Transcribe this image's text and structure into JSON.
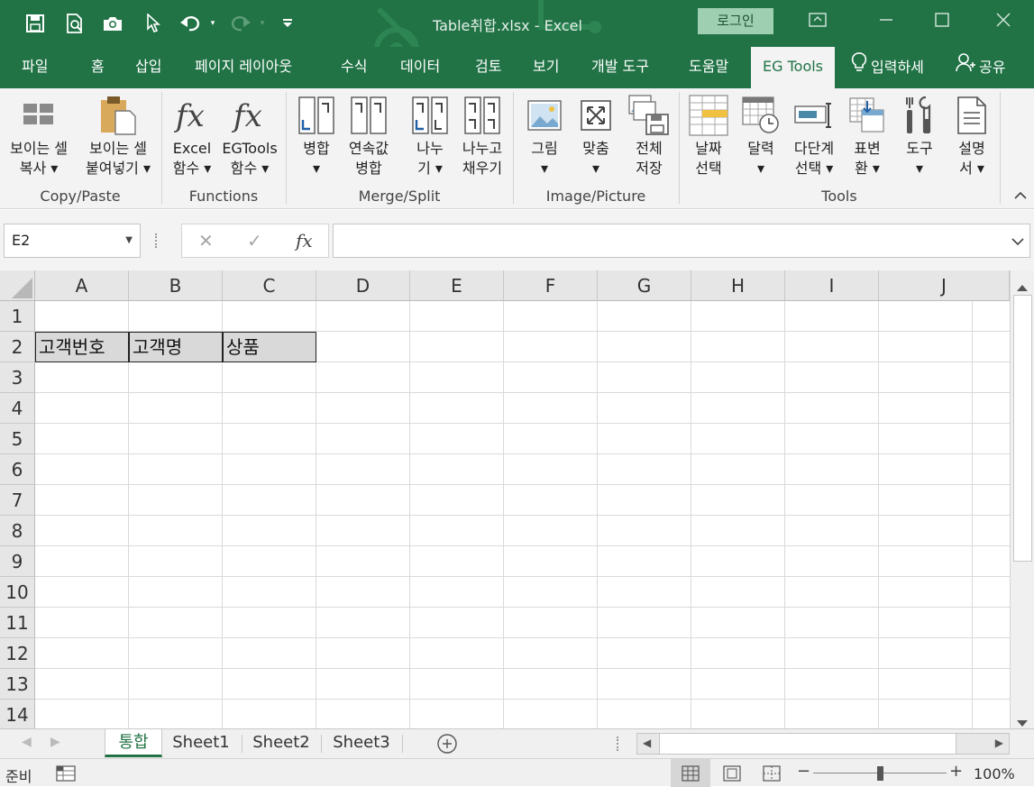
{
  "window": {
    "title": "Table취합.xlsx  -  Excel",
    "login_label": "로그인",
    "accent_color": "#217346"
  },
  "quick_access": {
    "icons": [
      "save-icon",
      "print-preview-icon",
      "camera-icon",
      "pointer-icon",
      "undo-icon",
      "redo-icon",
      "customize-icon"
    ]
  },
  "tabs": [
    {
      "label": "파일"
    },
    {
      "label": "홈"
    },
    {
      "label": "삽입"
    },
    {
      "label": "페이지 레이아웃"
    },
    {
      "label": "수식"
    },
    {
      "label": "데이터"
    },
    {
      "label": "검토"
    },
    {
      "label": "보기"
    },
    {
      "label": "개발 도구"
    },
    {
      "label": "도움말"
    },
    {
      "label": "EG Tools",
      "active": true
    },
    {
      "label": "입력하세"
    },
    {
      "label": "공유"
    }
  ],
  "ribbon": {
    "groups": [
      {
        "label": "Copy/Paste",
        "buttons": [
          {
            "line1": "보이는 셀",
            "line2": "복사 ▾"
          },
          {
            "line1": "보이는 셀",
            "line2": "붙여넣기 ▾"
          }
        ]
      },
      {
        "label": "Functions",
        "buttons": [
          {
            "line1": "Excel",
            "line2": "함수 ▾"
          },
          {
            "line1": "EGTools",
            "line2": "함수 ▾"
          }
        ]
      },
      {
        "label": "Merge/Split",
        "buttons": [
          {
            "line1": "병합",
            "line2": "▾"
          },
          {
            "line1": "연속값",
            "line2": "병합"
          },
          {
            "line1": "나누",
            "line2": "기 ▾"
          },
          {
            "line1": "나누고",
            "line2": "채우기"
          }
        ]
      },
      {
        "label": "Image/Picture",
        "buttons": [
          {
            "line1": "그림",
            "line2": "▾"
          },
          {
            "line1": "맞춤",
            "line2": "▾"
          },
          {
            "line1": "전체",
            "line2": "저장"
          }
        ]
      },
      {
        "label": "Tools",
        "buttons": [
          {
            "line1": "날짜",
            "line2": "선택"
          },
          {
            "line1": "달력",
            "line2": "▾"
          },
          {
            "line1": "다단계",
            "line2": "선택 ▾"
          },
          {
            "line1": "표변",
            "line2": "환 ▾"
          },
          {
            "line1": "도구",
            "line2": "▾"
          },
          {
            "line1": "설명",
            "line2": "서 ▾"
          }
        ]
      }
    ]
  },
  "formula_bar": {
    "name_box": "E2",
    "fx_label": "fx",
    "cancel_glyph": "✕",
    "enter_glyph": "✓",
    "formula": ""
  },
  "grid": {
    "columns": [
      "A",
      "B",
      "C",
      "D",
      "E",
      "F",
      "G",
      "H",
      "I",
      "J"
    ],
    "rows": [
      "1",
      "2",
      "3",
      "4",
      "5",
      "6",
      "7",
      "8",
      "9",
      "10",
      "11",
      "12",
      "13",
      "14"
    ],
    "cells": {
      "A2": "고객번호",
      "B2": "고객명",
      "C2": "상품"
    },
    "header_fill": "#d9d9d9"
  },
  "sheet_tabs": [
    {
      "label": "통합",
      "active": true
    },
    {
      "label": "Sheet1"
    },
    {
      "label": "Sheet2"
    },
    {
      "label": "Sheet3"
    }
  ],
  "status": {
    "ready": "준비",
    "zoom": "100%",
    "zoom_fraction": 0.5
  }
}
